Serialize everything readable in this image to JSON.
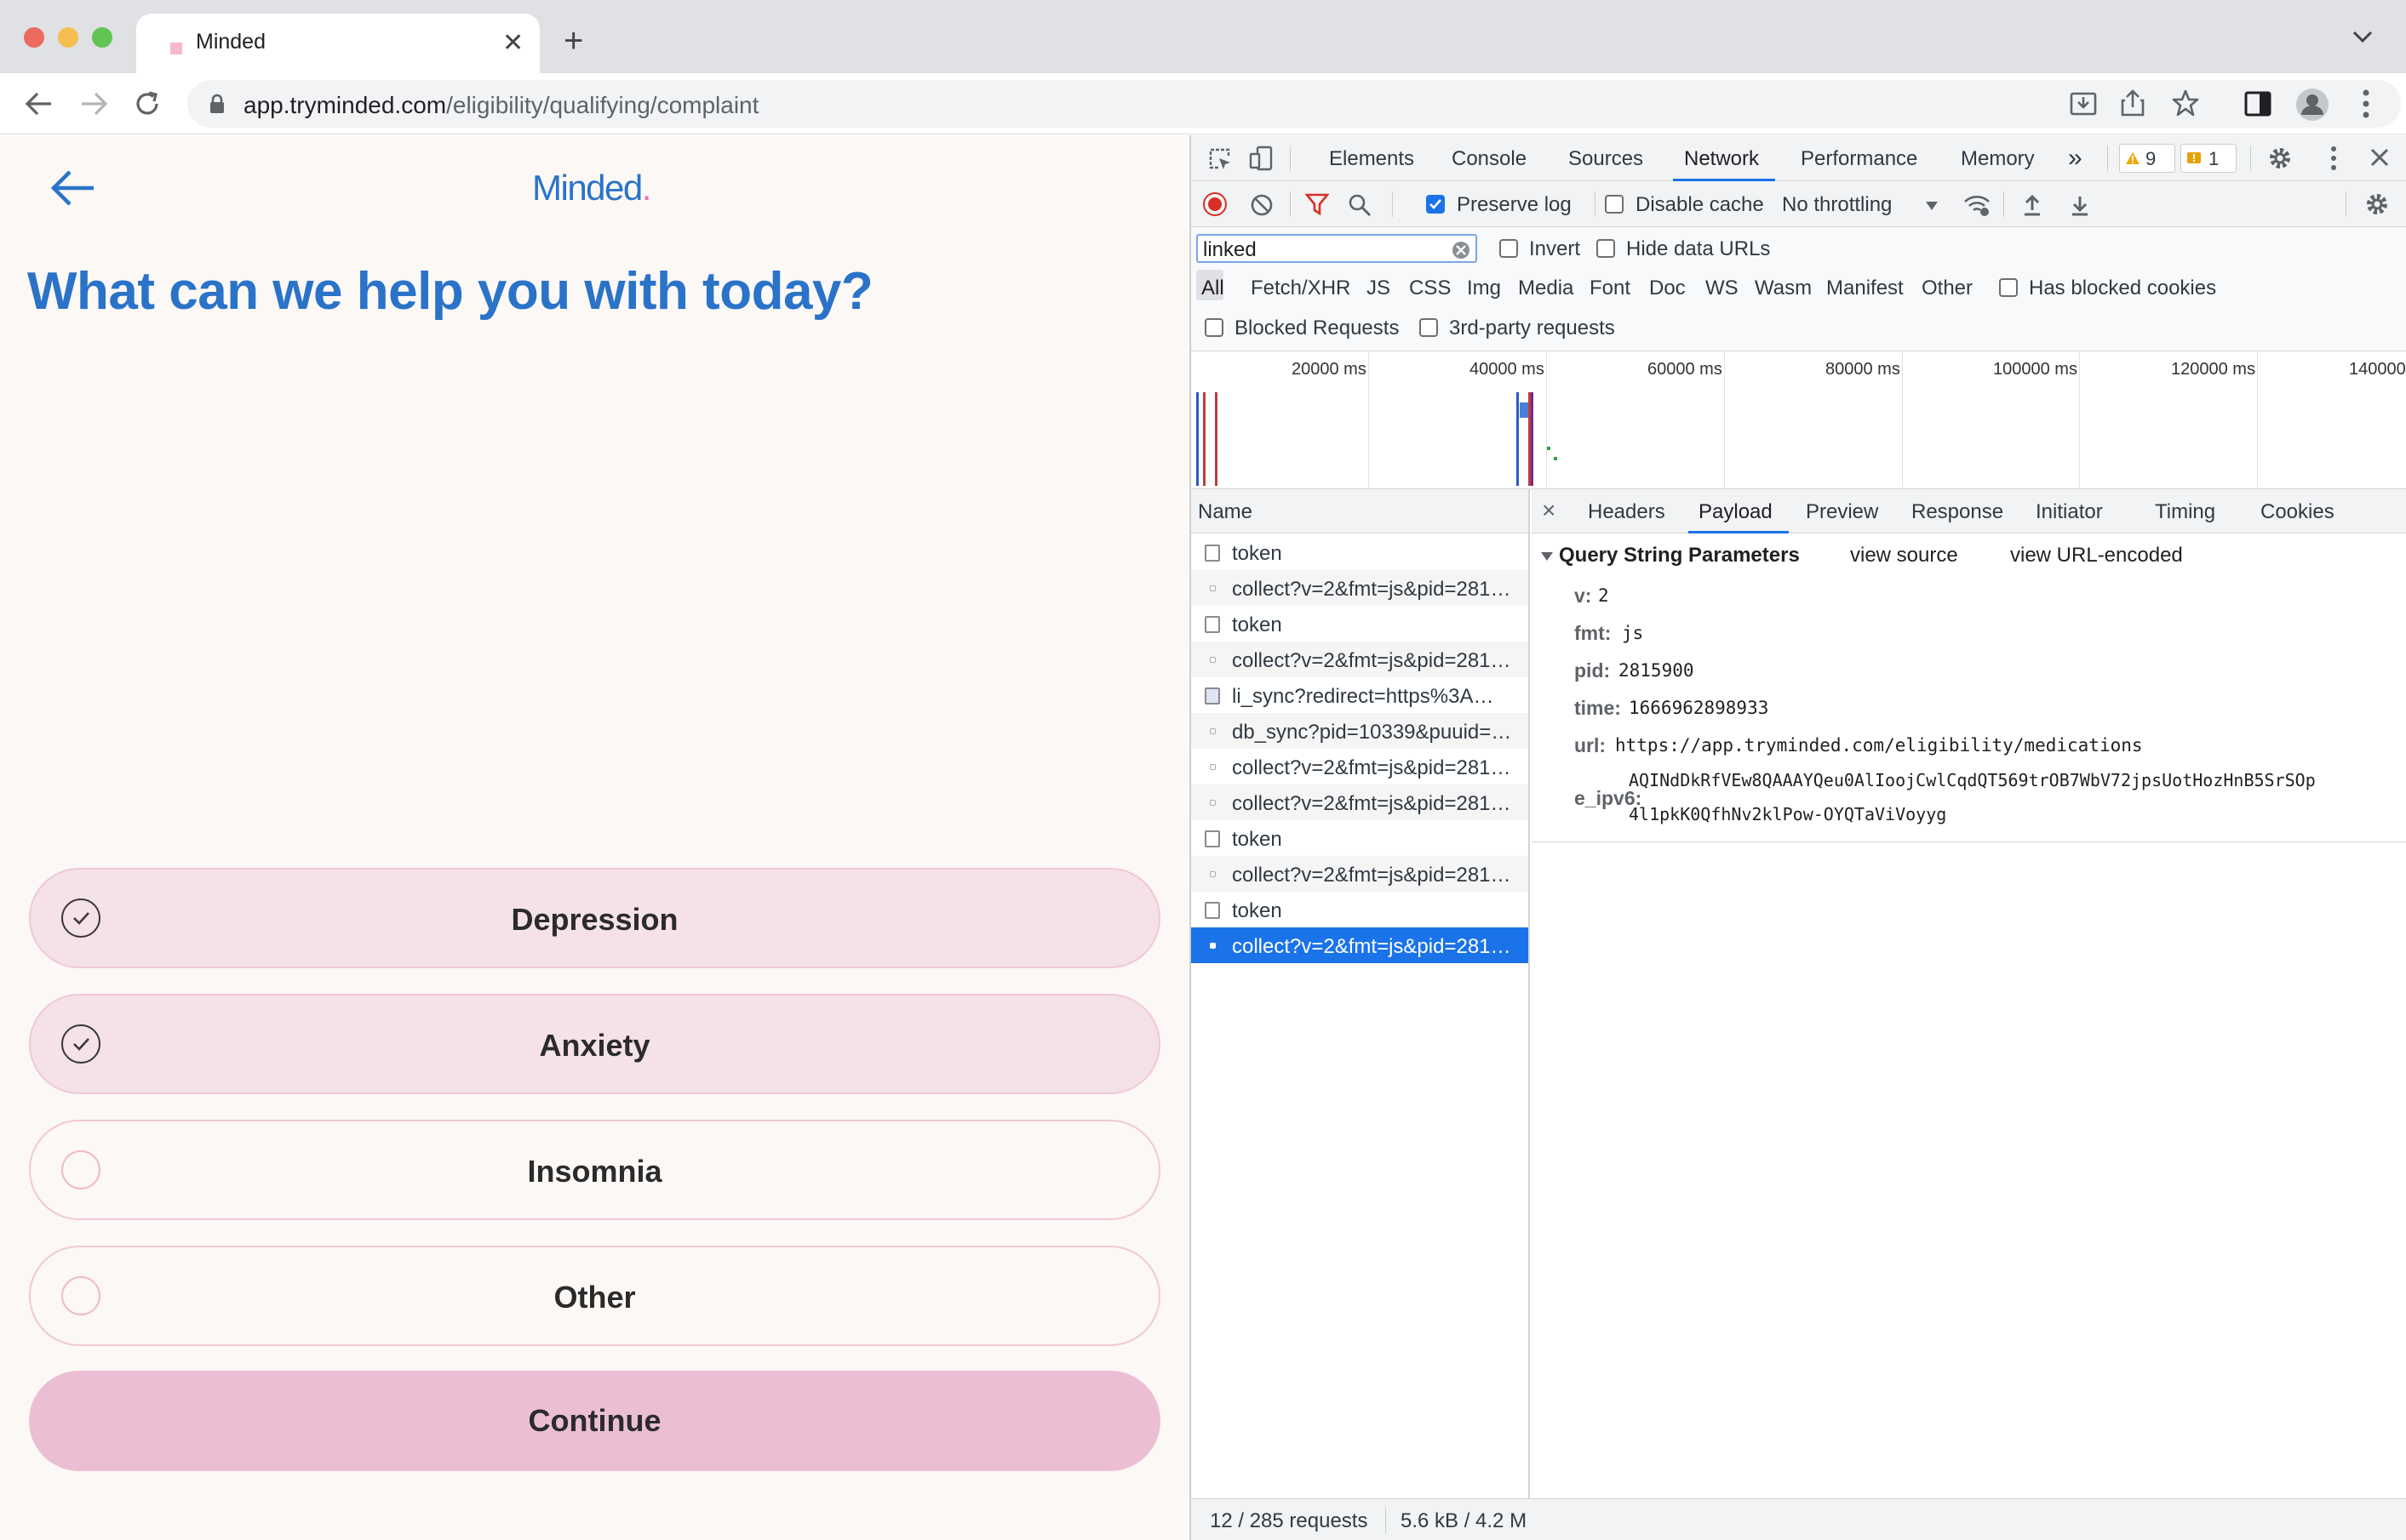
{
  "browser": {
    "tab_title": "Minded",
    "url_host": "app.tryminded.com",
    "url_path": "/eligibility/qualifying/complaint"
  },
  "page": {
    "logo": "Minded",
    "logo_dot": ".",
    "title": "What can we help you with today?",
    "options": [
      {
        "label": "Depression",
        "selected": true
      },
      {
        "label": "Anxiety",
        "selected": true
      },
      {
        "label": "Insomnia",
        "selected": false
      },
      {
        "label": "Other",
        "selected": false
      }
    ],
    "continue_label": "Continue"
  },
  "devtools": {
    "tabs": [
      "Elements",
      "Console",
      "Sources",
      "Network",
      "Performance",
      "Memory"
    ],
    "active_tab": "Network",
    "more_tabs": "»",
    "warnings_count": "9",
    "errors_count": "1",
    "toolbar": {
      "preserve_log": "Preserve log",
      "preserve_log_checked": true,
      "disable_cache": "Disable cache",
      "throttling": "No throttling"
    },
    "filter": {
      "value": "linked",
      "invert": "Invert",
      "hide_data_urls": "Hide data URLs",
      "types": [
        "All",
        "Fetch/XHR",
        "JS",
        "CSS",
        "Img",
        "Media",
        "Font",
        "Doc",
        "WS",
        "Wasm",
        "Manifest",
        "Other"
      ],
      "active_type": "All",
      "has_blocked_cookies": "Has blocked cookies",
      "blocked_requests": "Blocked Requests",
      "third_party": "3rd-party requests"
    },
    "timeline_ticks": [
      "20000 ms",
      "40000 ms",
      "60000 ms",
      "80000 ms",
      "100000 ms",
      "120000 ms",
      "140000"
    ],
    "name_header": "Name",
    "requests": [
      {
        "name": "token",
        "icon": "doc"
      },
      {
        "name": "collect?v=2&fmt=js&pid=281…",
        "icon": "dot"
      },
      {
        "name": "token",
        "icon": "doc"
      },
      {
        "name": "collect?v=2&fmt=js&pid=281…",
        "icon": "dot"
      },
      {
        "name": "li_sync?redirect=https%3A…",
        "icon": "img"
      },
      {
        "name": "db_sync?pid=10339&puuid=…",
        "icon": "dot"
      },
      {
        "name": "collect?v=2&fmt=js&pid=281…",
        "icon": "dot"
      },
      {
        "name": "collect?v=2&fmt=js&pid=281…",
        "icon": "dot"
      },
      {
        "name": "token",
        "icon": "doc"
      },
      {
        "name": "collect?v=2&fmt=js&pid=281…",
        "icon": "dot"
      },
      {
        "name": "token",
        "icon": "doc"
      },
      {
        "name": "collect?v=2&fmt=js&pid=281…",
        "icon": "dot",
        "selected": true
      }
    ],
    "detail_tabs": [
      "Headers",
      "Payload",
      "Preview",
      "Response",
      "Initiator",
      "Timing",
      "Cookies"
    ],
    "active_detail_tab": "Payload",
    "close_detail": "×",
    "qsp": {
      "heading": "Query String Parameters",
      "view_source": "view source",
      "view_url_encoded": "view URL-encoded",
      "params": [
        {
          "key": "v:",
          "value": "2"
        },
        {
          "key": "fmt:",
          "value": "js"
        },
        {
          "key": "pid:",
          "value": "2815900"
        },
        {
          "key": "time:",
          "value": "1666962898933"
        },
        {
          "key": "url:",
          "value": "https://app.tryminded.com/eligibility/medications"
        }
      ],
      "ipv6_key": "e_ipv6:",
      "ipv6_line1": "AQINdDkRfVEw8QAAAYQeu0AlIoojCwlCqdQT569trOB7WbV72jpsUotHozHnB5SrSOp",
      "ipv6_line2": "4l1pkK0QfhNv2klPow-OYQTaViVoyyg"
    },
    "status": {
      "requests": "12 / 285 requests",
      "transferred": "5.6 kB / 4.2 M"
    }
  }
}
